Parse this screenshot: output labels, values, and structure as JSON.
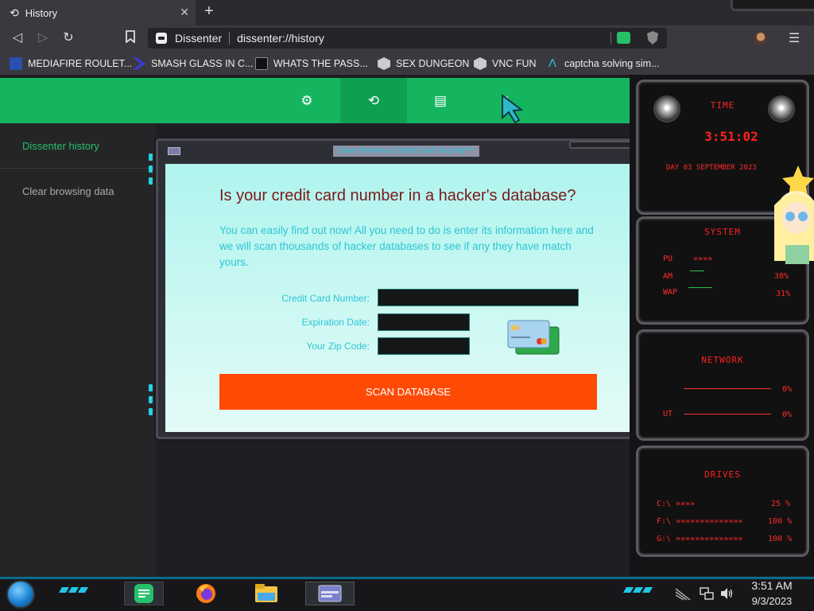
{
  "browser": {
    "tab": {
      "title": "History",
      "close": "✕"
    },
    "new_tab": "+",
    "nav": {
      "back": "◁",
      "forward": "▷",
      "reload": "↻",
      "bookmark": "🔖"
    },
    "url": {
      "site": "Dissenter",
      "address": "dissenter://history"
    },
    "menu": "☰",
    "bookmarks": [
      {
        "label": "MEDIAFIRE ROULET...",
        "icon": "mediafire-icon",
        "color": "#2a4fb0"
      },
      {
        "label": "SMASH GLASS IN C...",
        "icon": "chevron-icon",
        "color": "#3b3bd0"
      },
      {
        "label": "WHATS THE PASS...",
        "icon": "terminal-icon",
        "color": "#111111"
      },
      {
        "label": "SEX DUNGEON",
        "icon": "cube-icon",
        "color": "#dddddd"
      },
      {
        "label": "VNC FUN",
        "icon": "cube-icon",
        "color": "#dddddd"
      },
      {
        "label": "captcha solving sim...",
        "icon": "arrow-icon",
        "color": "#2bc5d0"
      }
    ]
  },
  "page": {
    "header_icons": [
      "gear-icon",
      "history-icon",
      "bookmark-icon",
      "download-icon"
    ],
    "header_glyphs": {
      "gear": "⚙",
      "history": "⟲",
      "bookmarks": "▤",
      "downloads": "⤓"
    },
    "sidebar": [
      {
        "label": "Dissenter history",
        "color": "#27c06a"
      },
      {
        "label": "Clear browsing data",
        "color": "#aaaaaa"
      }
    ]
  },
  "popup": {
    "window_title": "Dave Normous Credit Card Security™",
    "heading": "Is your credit card number in a hacker's database?",
    "description": "You can easily find out now! All you need to do is enter its information here and we will scan thousands of hacker databases to see if any they have match yours.",
    "fields": {
      "card_number_label": "Credit Card Number:",
      "expiration_label": "Expiration Date:",
      "zip_label": "Your Zip Code:"
    },
    "button": "SCAN DATABASE"
  },
  "widgets": {
    "time_title": "TIME",
    "time": "3:51:02",
    "date_line": "DAY 03 SEPTEMBER 2023",
    "system_title": "SYSTEM",
    "system_rows": [
      {
        "label": "PU",
        "value": ""
      },
      {
        "label": "AM",
        "value": "38%"
      },
      {
        "label": "WAP",
        "value": "31%"
      }
    ],
    "network_title": "NETWORK",
    "network_rows": [
      {
        "label": "",
        "value": "0%"
      },
      {
        "label": "UT",
        "value": "0%"
      }
    ],
    "drives_title": "DRIVES",
    "drives": [
      {
        "label": "C:\\",
        "value": "25 %"
      },
      {
        "label": "F:\\",
        "value": "100 %"
      },
      {
        "label": "G:\\",
        "value": "100 %"
      }
    ]
  },
  "taskbar": {
    "time": "3:51 AM",
    "date": "9/3/2023",
    "apps": [
      "chat-app-icon",
      "firefox-icon",
      "file-explorer-icon",
      "window-app-icon"
    ]
  },
  "colors": {
    "accent": "#15b560",
    "scan_button": "#ff4a05",
    "widget_red": "#ff2222"
  }
}
